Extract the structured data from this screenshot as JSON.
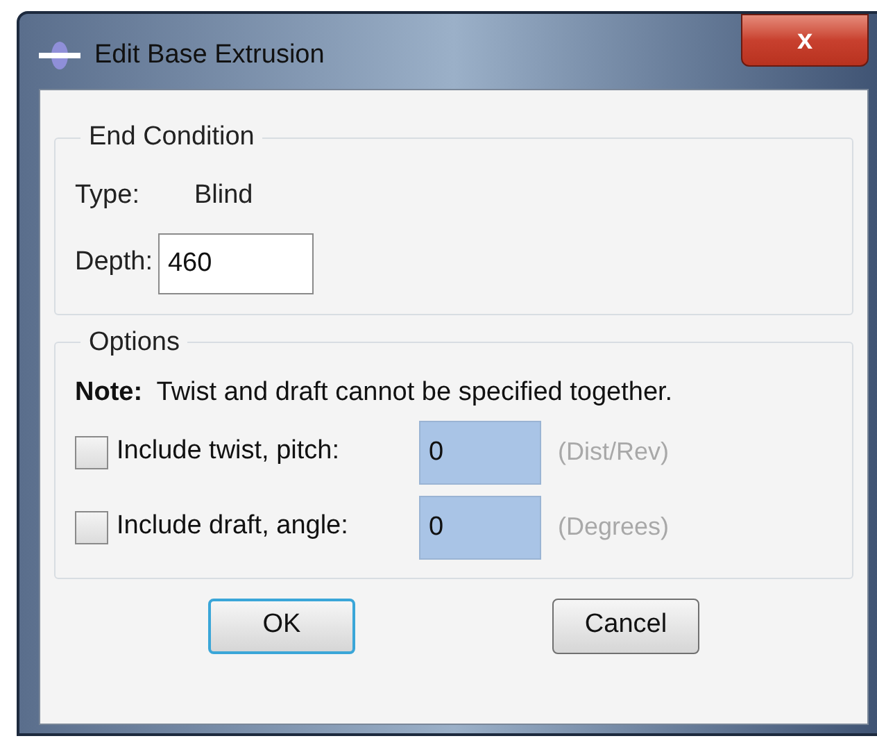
{
  "window": {
    "title": "Edit Base Extrusion",
    "close_label": "x"
  },
  "end_condition": {
    "title": "End Condition",
    "type_label": "Type:",
    "type_value": "Blind",
    "depth_label": "Depth:",
    "depth_value": "460"
  },
  "options": {
    "title": "Options",
    "note": "**Note:**  Twist and draft cannot be specified together.",
    "rows": [
      {
        "label": "Include twist, pitch:",
        "checked": false,
        "value": "0",
        "unit": "(Dist/Rev)",
        "disabled": true
      },
      {
        "label": "Include draft, angle:",
        "checked": false,
        "value": "0",
        "unit": "(Degrees)",
        "disabled": true
      }
    ]
  },
  "buttons": [
    {
      "label": "OK",
      "default": true
    },
    {
      "label": "Cancel",
      "default": false
    }
  ]
}
